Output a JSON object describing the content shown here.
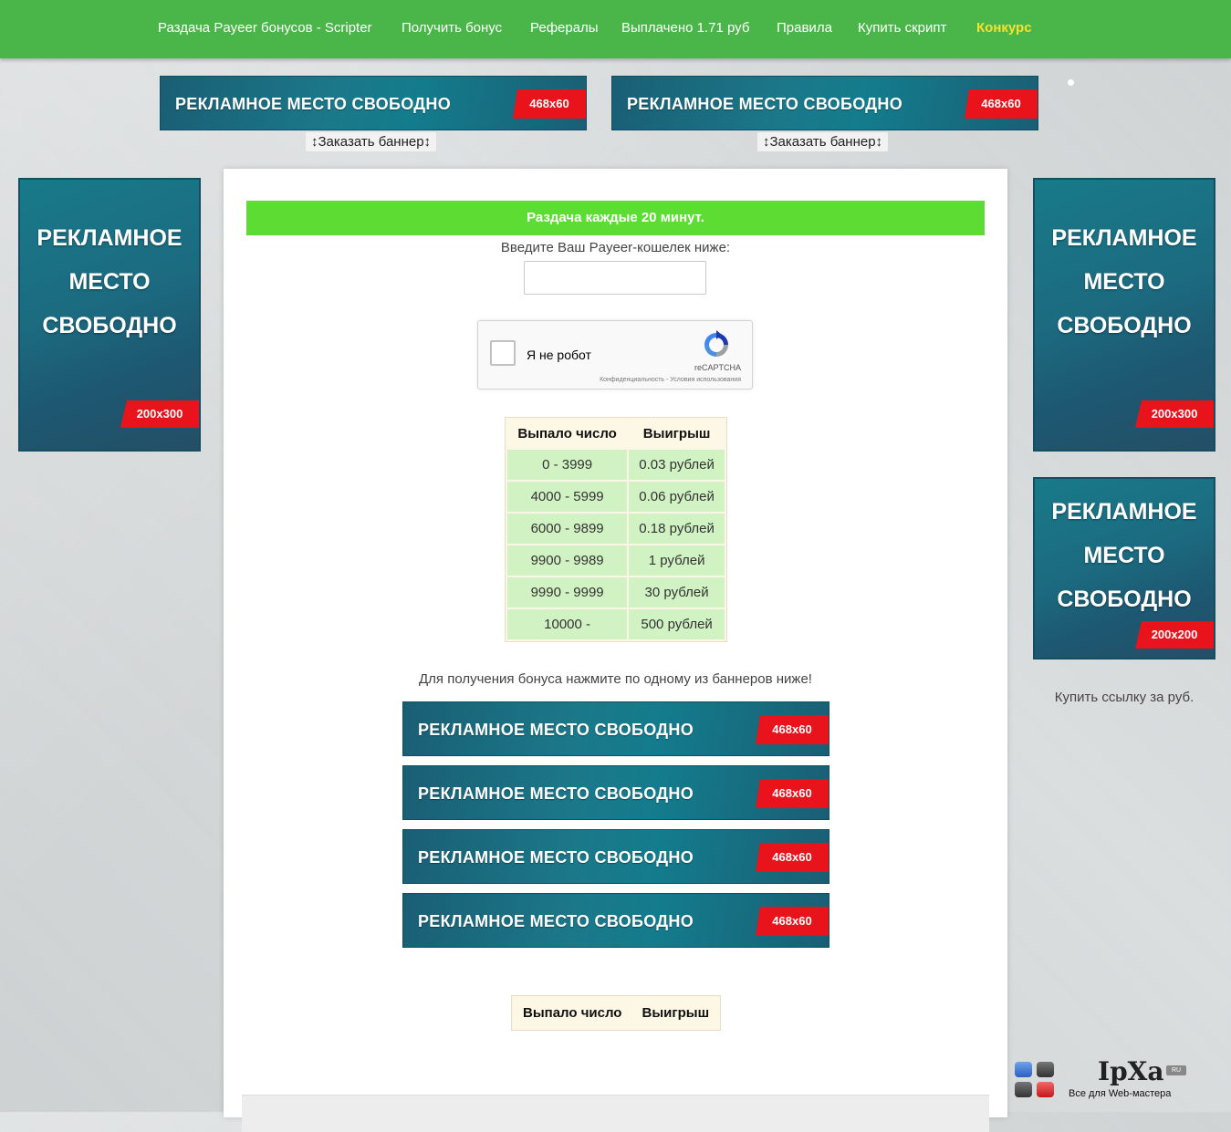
{
  "nav": {
    "items": [
      "Раздача Payeer бонусов - Scripter",
      "Получить бонус",
      "Рефералы",
      "Выплачено 1.71 руб",
      "Правила",
      "Купить скрипт",
      "Конкурс"
    ]
  },
  "banners": {
    "text": "РЕКЛАМНОЕ  МЕСТО СВОБОДНО",
    "size_468": "468x60",
    "order": "↕Заказать баннер↕",
    "vertical_lines": [
      "РЕКЛАМНОЕ",
      "МЕСТО",
      "СВОБОДНО"
    ],
    "size_200x300": "200x300",
    "size_200x200": "200x200"
  },
  "main": {
    "header": "Раздача каждые 20 минут.",
    "wallet_label": "Введите Ваш Payeer-кошелек ниже:",
    "wallet_value": "",
    "captcha": {
      "label": "Я не робот",
      "brand": "reCAPTCHA",
      "links": "Конфиденциальность - Условия использования"
    },
    "table": {
      "headers": [
        "Выпало число",
        "Выигрыш"
      ],
      "rows": [
        [
          "0 - 3999",
          "0.03 рублей"
        ],
        [
          "4000 - 5999",
          "0.06 рублей"
        ],
        [
          "6000 - 9899",
          "0.18 рублей"
        ],
        [
          "9900 - 9989",
          "1 рублей"
        ],
        [
          "9990 - 9999",
          "30 рублей"
        ],
        [
          "10000 -",
          "500 рублей"
        ]
      ]
    },
    "bonus_note": "Для получения бонуса нажмите по одному из баннеров ниже!",
    "table2_headers": [
      "Выпало число",
      "Выигрыш"
    ]
  },
  "sidebar": {
    "buy_link": "Купить ссылку за руб."
  },
  "logo": {
    "name": "IpXa",
    "badge": "RU",
    "tagline": "Все для Web-мастера"
  },
  "colors": {
    "nav_bg": "#4ab64a",
    "nav_highlight": "#f7e12f",
    "header_bar": "#5ddc34",
    "banner_bg": "#1b7889",
    "badge_red": "#e8131b",
    "table_cell": "#d1f2c3"
  }
}
